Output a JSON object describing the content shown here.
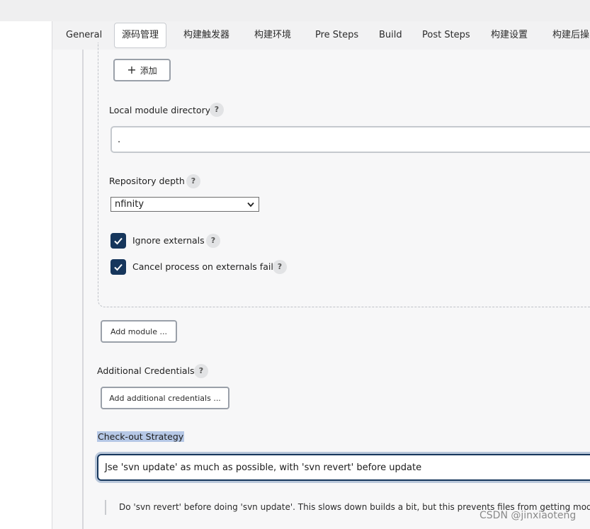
{
  "tabs": [
    "General",
    "源码管理",
    "构建触发器",
    "构建环境",
    "Pre Steps",
    "Build",
    "Post Steps",
    "构建设置",
    "构建后操"
  ],
  "add_button_label": "添加",
  "local_module_directory": {
    "label": "Local module directory",
    "value": "."
  },
  "repository_depth": {
    "label": "Repository depth",
    "value": "nfinity"
  },
  "ignore_externals": {
    "label": "Ignore externals",
    "checked": true
  },
  "cancel_process": {
    "label": "Cancel process on externals fail",
    "checked": true
  },
  "add_module_label": "Add module ...",
  "additional_credentials": {
    "label": "Additional Credentials",
    "button_label": "Add additional credentials ..."
  },
  "checkout_strategy": {
    "label": "Check-out Strategy",
    "value": "Jse 'svn update' as much as possible, with 'svn revert' before update",
    "description": "Do 'svn revert' before doing 'svn update'. This slows down builds a bit, but this prevents files from getting modifie"
  },
  "help_glyph": "?",
  "watermark": "CSDN @jinxiaoteng",
  "colors": {
    "accent": "#16365c",
    "help_bg": "#e2e3e5",
    "highlight": "#b6c8e6"
  }
}
